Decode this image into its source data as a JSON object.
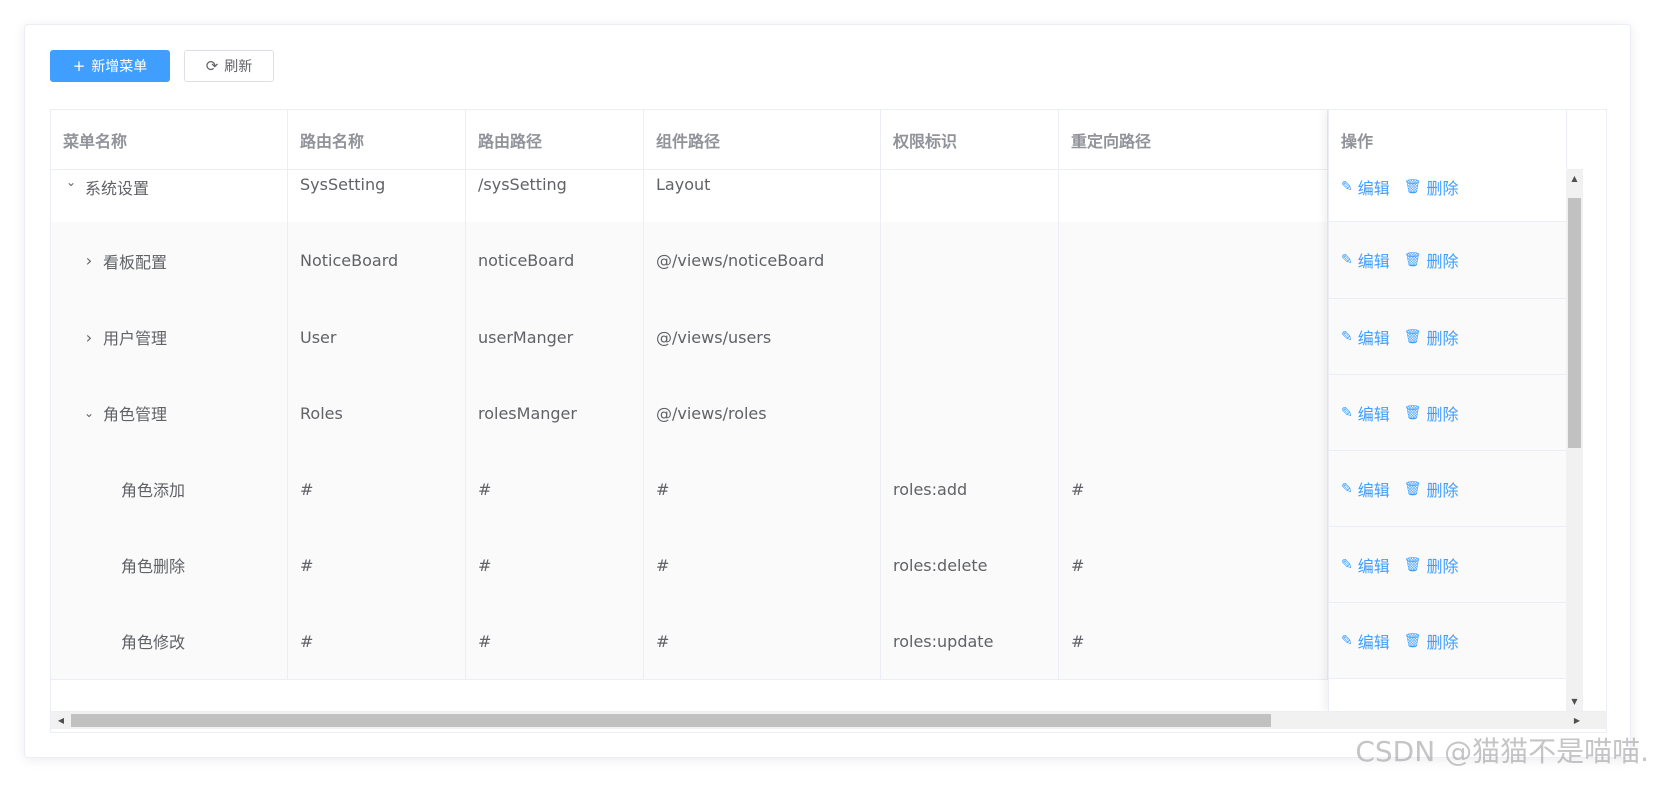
{
  "toolbar": {
    "add_label": "新增菜单",
    "refresh_label": "刷新"
  },
  "columns": [
    "菜单名称",
    "路由名称",
    "路由路径",
    "组件路径",
    "权限标识",
    "重定向路径",
    "操作"
  ],
  "rows": [
    {
      "name": "系统设置",
      "expander": "collapse",
      "route_name": "SysSetting",
      "path": "/sysSetting",
      "component": "Layout",
      "perm": "",
      "redirect": ""
    },
    {
      "name": "看板配置",
      "expander": "expand",
      "route_name": "NoticeBoard",
      "path": "noticeBoard",
      "component": "@/views/noticeBoard",
      "perm": "",
      "redirect": ""
    },
    {
      "name": "用户管理",
      "expander": "expand",
      "route_name": "User",
      "path": "userManger",
      "component": "@/views/users",
      "perm": "",
      "redirect": ""
    },
    {
      "name": "角色管理",
      "expander": "collapse",
      "route_name": "Roles",
      "path": "rolesManger",
      "component": "@/views/roles",
      "perm": "",
      "redirect": ""
    },
    {
      "name": "角色添加",
      "expander": "",
      "route_name": "#",
      "path": "#",
      "component": "#",
      "perm": "roles:add",
      "redirect": "#"
    },
    {
      "name": "角色删除",
      "expander": "",
      "route_name": "#",
      "path": "#",
      "component": "#",
      "perm": "roles:delete",
      "redirect": "#"
    },
    {
      "name": "角色修改",
      "expander": "",
      "route_name": "#",
      "path": "#",
      "component": "#",
      "perm": "roles:update",
      "redirect": "#"
    }
  ],
  "actions": {
    "edit_label": "编辑",
    "delete_label": "删除"
  },
  "watermark": "CSDN @猫猫不是喵喵.",
  "colors": {
    "primary": "#409eff",
    "header_text": "#909399",
    "cell_text": "#606266"
  }
}
